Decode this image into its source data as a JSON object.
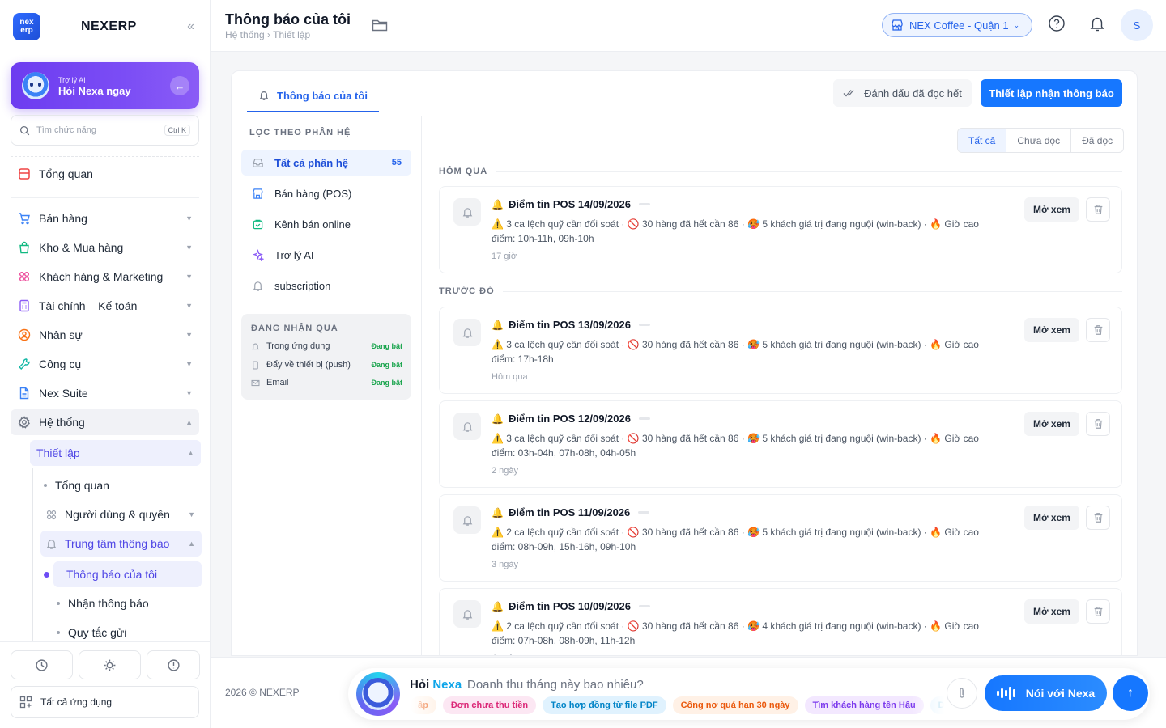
{
  "brand": {
    "logo": "nex erp",
    "name": "NEXERP"
  },
  "ai": {
    "small": "Trợ lý AI",
    "big": "Hỏi Nexa ngay"
  },
  "search": {
    "placeholder": "Tìm chức năng",
    "shortcut": "Ctrl K"
  },
  "nav": {
    "overview": "Tổng quan",
    "items": [
      {
        "label": "Bán hàng",
        "icon": "cart-icon",
        "color": "#3b82f6"
      },
      {
        "label": "Kho & Mua hàng",
        "icon": "bag-icon",
        "color": "#10b981"
      },
      {
        "label": "Khách hàng & Marketing",
        "icon": "users-icon",
        "color": "#ec4899"
      },
      {
        "label": "Tài chính – Kế toán",
        "icon": "calculator-icon",
        "color": "#8b5cf6"
      },
      {
        "label": "Nhân sự",
        "icon": "person-icon",
        "color": "#f97316"
      },
      {
        "label": "Công cụ",
        "icon": "wrench-icon",
        "color": "#14b8a6"
      },
      {
        "label": "Nex Suite",
        "icon": "document-icon",
        "color": "#3b82f6"
      },
      {
        "label": "Hệ thống",
        "icon": "gear-icon",
        "color": "#6b7280"
      }
    ],
    "setup": "Thiết lập",
    "sub_overview": "Tổng quan",
    "users_roles": "Người dùng & quyền",
    "notif_center": "Trung tâm thông báo",
    "my_notif": "Thông báo của tôi",
    "receive": "Nhận thông báo",
    "rules": "Quy tắc gửi",
    "all_apps": "Tất cả ứng dụng"
  },
  "header": {
    "title": "Thông báo của tôi",
    "breadcrumb": "Hệ thống › Thiết lập",
    "store": "NEX Coffee - Quận 1",
    "avatar": "S"
  },
  "tabs": {
    "active": "Thông báo của tôi",
    "mark_all": "Đánh dấu đã đọc hết",
    "setup": "Thiết lập nhận thông báo"
  },
  "filters": {
    "title": "LỌC THEO PHÂN HỆ",
    "items": [
      {
        "label": "Tất cả phân hệ",
        "count": "55",
        "icon": "inbox-icon",
        "color": "#9ca3af"
      },
      {
        "label": "Bán hàng (POS)",
        "count": "",
        "icon": "store-icon",
        "color": "#3b82f6"
      },
      {
        "label": "Kênh bán online",
        "count": "",
        "icon": "online-shop-icon",
        "color": "#10b981"
      },
      {
        "label": "Trợ lý AI",
        "count": "",
        "icon": "sparkle-icon",
        "color": "#8b5cf6"
      },
      {
        "label": "subscription",
        "count": "",
        "icon": "bell-icon",
        "color": "#9ca3af"
      }
    ]
  },
  "receiving": {
    "title": "ĐANG NHẬN QUA",
    "rows": [
      {
        "label": "Trong ứng dụng",
        "status": "Đang bật"
      },
      {
        "label": "Đẩy về thiết bị (push)",
        "status": "Đang bật"
      },
      {
        "label": "Email",
        "status": "Đang bật"
      }
    ]
  },
  "segments": [
    "Tất cả",
    "Chưa đọc",
    "Đã đọc"
  ],
  "groups": {
    "yesterday": "HÔM QUA",
    "earlier": "TRƯỚC ĐÓ"
  },
  "card_actions": {
    "open": "Mở xem"
  },
  "notifications": [
    {
      "title": "Điểm tin POS 14/09/2026",
      "body": "⚠️ 3 ca lệch quỹ cần đối soát · 🚫 30 hàng đã hết cần 86 · 🥵 5 khách giá trị đang nguội (win-back) · 🔥 Giờ cao điểm: 10h-11h, 09h-10h",
      "time": "17 giờ"
    },
    {
      "title": "Điểm tin POS 13/09/2026",
      "body": "⚠️ 3 ca lệch quỹ cần đối soát · 🚫 30 hàng đã hết cần 86 · 🥵 5 khách giá trị đang nguội (win-back) · 🔥 Giờ cao điểm: 17h-18h",
      "time": "Hôm qua"
    },
    {
      "title": "Điểm tin POS 12/09/2026",
      "body": "⚠️ 3 ca lệch quỹ cần đối soát · 🚫 30 hàng đã hết cần 86 · 🥵 5 khách giá trị đang nguội (win-back) · 🔥 Giờ cao điểm: 03h-04h, 07h-08h, 04h-05h",
      "time": "2 ngày"
    },
    {
      "title": "Điểm tin POS 11/09/2026",
      "body": "⚠️ 2 ca lệch quỹ cần đối soát · 🚫 30 hàng đã hết cần 86 · 🥵 5 khách giá trị đang nguội (win-back) · 🔥 Giờ cao điểm: 08h-09h, 15h-16h, 09h-10h",
      "time": "3 ngày"
    },
    {
      "title": "Điểm tin POS 10/09/2026",
      "body": "⚠️ 2 ca lệch quỹ cần đối soát · 🚫 30 hàng đã hết cần 86 · 🥵 4 khách giá trị đang nguội (win-back) · 🔥 Giờ cao điểm: 07h-08h, 08h-09h, 11h-12h",
      "time": "4 ngày"
    }
  ],
  "footer": {
    "copyright": "2026 © NEXERP",
    "ask": "Hỏi",
    "nexa": "Nexa",
    "question": "Doanh thu tháng này bao nhiêu?",
    "chips": [
      {
        "label": "ập",
        "bg": "#fff1e6",
        "fg": "#ea580c"
      },
      {
        "label": "Đơn chưa thu tiền",
        "bg": "#fce7f3",
        "fg": "#db2777"
      },
      {
        "label": "Tạo hợp đồng từ file PDF",
        "bg": "#e0f2fe",
        "fg": "#0284c7"
      },
      {
        "label": "Công nợ quá hạn 30 ngày",
        "bg": "#fff1e6",
        "fg": "#ea580c"
      },
      {
        "label": "Tìm khách hàng tên Hậu",
        "bg": "#f3e8ff",
        "fg": "#7c3aed"
      },
      {
        "label": "Do",
        "bg": "#e0f2fe",
        "fg": "#0284c7"
      }
    ],
    "talk": "Nói với Nexa"
  }
}
